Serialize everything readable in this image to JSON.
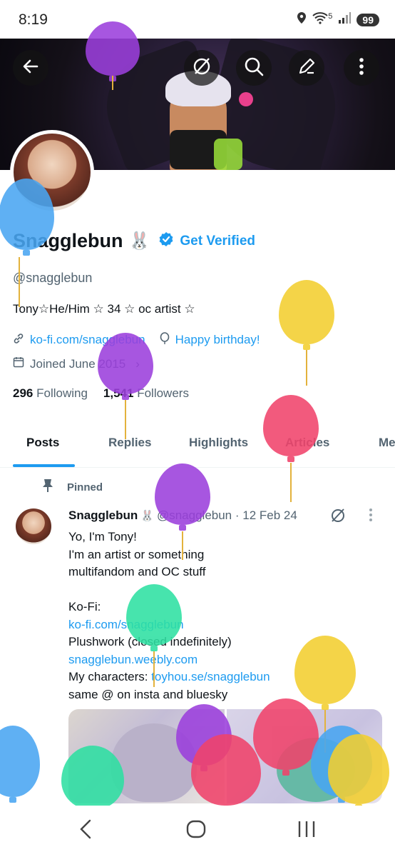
{
  "status_bar": {
    "time": "8:19",
    "signal_label": "5",
    "battery": "99"
  },
  "profile": {
    "display_name": "Snagglebun",
    "name_emoji": "🐰",
    "get_verified_label": "Get Verified",
    "handle": "@snagglebun",
    "bio": "Tony☆He/Him ☆ 34 ☆ oc artist ☆",
    "website": "ko-fi.com/snagglebun",
    "birthday": "Happy birthday!",
    "joined": "Joined June 2015",
    "following_count": "296",
    "following_label": "Following",
    "followers_count": "1,541",
    "followers_label": "Followers"
  },
  "tabs": [
    {
      "label": "Posts"
    },
    {
      "label": "Replies"
    },
    {
      "label": "Highlights"
    },
    {
      "label": "Articles"
    },
    {
      "label": "Me"
    }
  ],
  "pinned_post": {
    "pinned_label": "Pinned",
    "author_name": "Snagglebun",
    "author_emoji": "🐰",
    "meta": "@snagglebun · 12 Feb 24",
    "lines": {
      "l1": "Yo, I'm Tony!",
      "l2": "I'm an artist or something",
      "l3": "multifandom and OC stuff",
      "l4": "Ko-Fi:",
      "l5_link": "ko-fi.com/snagglebun",
      "l6": "Plushwork (closed indefinitely)",
      "l7_link": "snagglebun.weebly.com",
      "l8_prefix": "My characters: ",
      "l8_link": "toyhou.se/snagglebun",
      "l9": "same @ on insta and bluesky"
    }
  },
  "icons": {
    "back": "back-arrow-icon",
    "grok": "grok-icon",
    "search": "search-icon",
    "edit": "edit-icon",
    "more": "more-vertical-icon"
  },
  "colors": {
    "accent": "#1d9bf0",
    "text": "#0f1419",
    "muted": "#536471"
  }
}
